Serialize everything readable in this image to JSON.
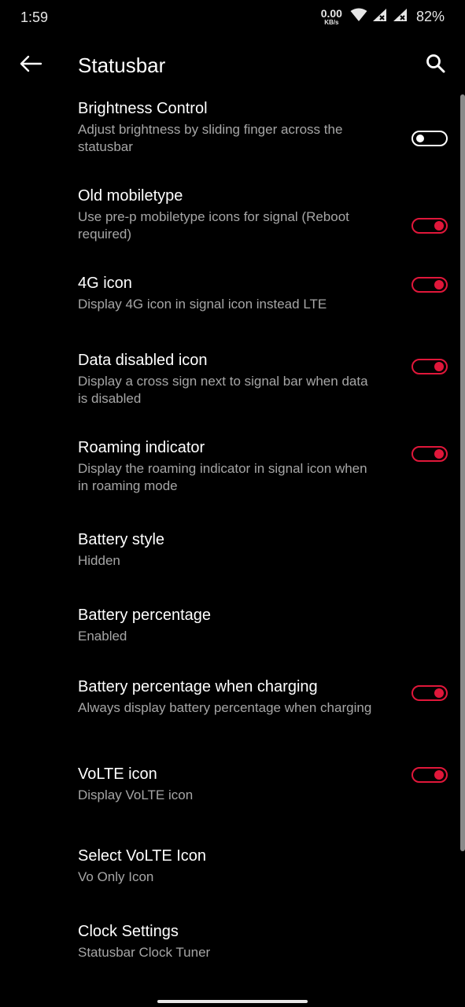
{
  "status_bar": {
    "time": "1:59",
    "speed_value": "0.00",
    "speed_unit": "KB/s",
    "battery": "82%",
    "icons": [
      "wifi-icon",
      "signal-x-icon",
      "signal-x-icon"
    ]
  },
  "app_bar": {
    "title": "Statusbar",
    "back_icon": "arrow-left-icon",
    "search_icon": "search-icon"
  },
  "accent_color": "#e0173a",
  "settings": [
    {
      "title": "Brightness Control",
      "subtitle": "Adjust brightness by sliding finger across the statusbar",
      "toggle": "off"
    },
    {
      "title": "Old mobiletype",
      "subtitle": "Use pre-p mobiletype icons for signal (Reboot required)",
      "toggle": "on"
    },
    {
      "title": "4G icon",
      "subtitle": "Display 4G icon in signal icon instead LTE",
      "toggle": "on"
    },
    {
      "title": "Data disabled icon",
      "subtitle": "Display a cross sign next to signal bar when data is disabled",
      "toggle": "on"
    },
    {
      "title": "Roaming indicator",
      "subtitle": "Display the roaming indicator in signal icon when in roaming mode",
      "toggle": "on"
    },
    {
      "title": "Battery style",
      "subtitle": "Hidden"
    },
    {
      "title": "Battery percentage",
      "subtitle": "Enabled"
    },
    {
      "title": "Battery percentage when charging",
      "subtitle": "Always display battery percentage when charging",
      "toggle": "on"
    },
    {
      "title": "VoLTE icon",
      "subtitle": "Display VoLTE icon",
      "toggle": "on"
    },
    {
      "title": "Select VoLTE Icon",
      "subtitle": "Vo Only Icon"
    },
    {
      "title": "Clock Settings",
      "subtitle": "Statusbar Clock Tuner"
    }
  ]
}
